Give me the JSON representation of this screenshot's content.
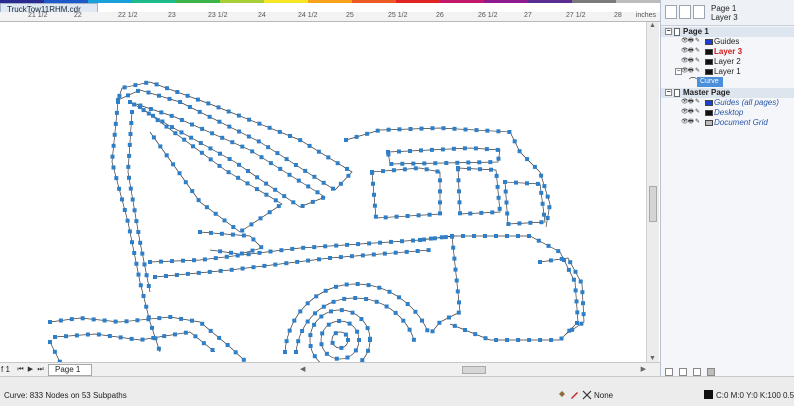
{
  "document_tab": "TruckTow11RHM.cdr",
  "ruler": {
    "labels": [
      "21 1/2",
      "22",
      "22 1/2",
      "23",
      "23 1/2",
      "24",
      "24 1/2",
      "25",
      "25 1/2",
      "26",
      "26 1/2",
      "27",
      "27 1/2",
      "28"
    ],
    "units": "inches"
  },
  "page_nav": {
    "of_label": "f 1",
    "page_tab": "Page 1"
  },
  "status": {
    "curve_info": "Curve: 833 Nodes on 53 Subpaths",
    "fill_none": "None",
    "outline_info": "C:0 M:0 Y:0 K:100  0.500 pt"
  },
  "docker": {
    "current_page": "Page 1",
    "current_layer": "Layer 3",
    "page1": {
      "label": "Page 1",
      "layers": [
        {
          "name": "Guides",
          "color": "#1f3fd0",
          "style": "normal"
        },
        {
          "name": "Layer 3",
          "color": "#111111",
          "style": "active"
        },
        {
          "name": "Layer 2",
          "color": "#111111",
          "style": "normal"
        },
        {
          "name": "Layer 1",
          "color": "#111111",
          "style": "normal"
        }
      ],
      "selected_object": "Curve"
    },
    "master": {
      "label": "Master Page",
      "layers": [
        {
          "name": "Guides (all pages)",
          "color": "#1f3fd0"
        },
        {
          "name": "Desktop",
          "color": "#111111"
        },
        {
          "name": "Document Grid",
          "color": "#bbbbbb"
        }
      ]
    }
  },
  "colors": {
    "node": "#2f7fc8",
    "path": "#3a3a3a",
    "selection": "#4a8fd9"
  },
  "canvas": {
    "node_count": "833",
    "subpath_count": "53"
  }
}
